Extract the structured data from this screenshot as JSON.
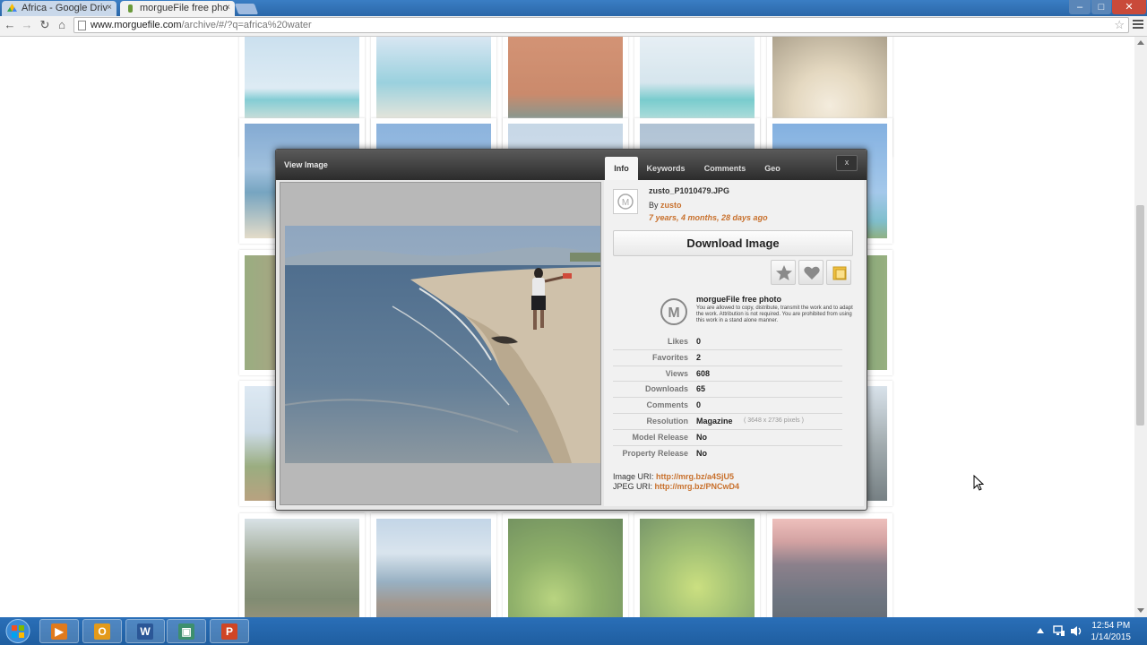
{
  "browser": {
    "tabs": [
      {
        "label": "Africa - Google Driv",
        "close": "×"
      },
      {
        "label": "morgueFile free pho",
        "close": "×"
      }
    ],
    "window_controls": {
      "minimize": "–",
      "maximize": "□",
      "close": "✕"
    },
    "nav": {
      "back": "←",
      "forward": "→",
      "reload": "↻",
      "home": "⌂"
    },
    "url_host": "www.morguefile.com",
    "url_path": "/archive/#/?q=africa%20water",
    "bookmark_star": "☆"
  },
  "modal": {
    "title": "View Image",
    "tabs": [
      "Info",
      "Keywords",
      "Comments",
      "Geo"
    ],
    "close_label": "x",
    "filename": "zusto_P1010479.JPG",
    "by_label": "By",
    "author": "zusto",
    "age": "7 years, 4 months, 28 days ago",
    "download_label": "Download Image",
    "license_title": "morgueFile free photo",
    "license_text": "You are allowed to copy, distribute, transmit the work and to adapt the work. Attribution is not required. You are prohibited from using this work in a stand alone manner.",
    "stats": [
      {
        "label": "Likes",
        "value": "0"
      },
      {
        "label": "Favorites",
        "value": "2"
      },
      {
        "label": "Views",
        "value": "608"
      },
      {
        "label": "Downloads",
        "value": "65"
      },
      {
        "label": "Comments",
        "value": "0"
      },
      {
        "label": "Resolution",
        "value": "Magazine",
        "extra": "( 3648 x 2736 pixels )"
      },
      {
        "label": "Model Release",
        "value": "No"
      },
      {
        "label": "Property Release",
        "value": "No"
      }
    ],
    "image_uri_label": "Image URI:",
    "image_uri": "http://mrg.bz/a4SjU5",
    "jpeg_uri_label": "JPEG URI:",
    "jpeg_uri": "http://mrg.bz/PNCwD4"
  },
  "taskbar": {
    "apps": [
      {
        "name": "media-player",
        "glyph": "▶",
        "color": "#e07a1c"
      },
      {
        "name": "outlook",
        "glyph": "O",
        "color": "#e39a1a"
      },
      {
        "name": "word",
        "glyph": "W",
        "color": "#2b5797"
      },
      {
        "name": "window-app",
        "glyph": "▣",
        "color": "#3d8f6e"
      },
      {
        "name": "powerpoint",
        "glyph": "P",
        "color": "#d04525"
      }
    ],
    "time": "12:54 PM",
    "date": "1/14/2015"
  },
  "colors": {
    "accent_link": "#c8702c",
    "modal_header": "#3a3a3a",
    "taskbar": "#2a6fb8"
  }
}
